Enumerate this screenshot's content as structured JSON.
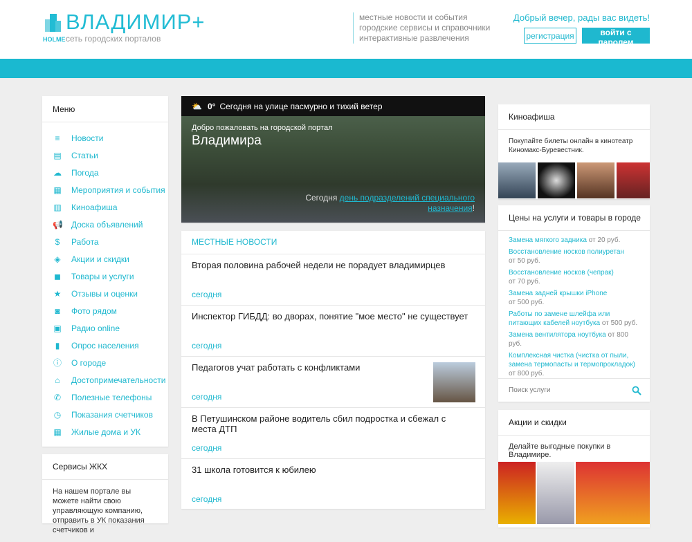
{
  "header": {
    "logo_title": "ВЛАДИМИР+",
    "logo_brand": "HOLME",
    "logo_subtitle": "сеть городских порталов",
    "taglines": [
      "местные новости и события",
      "городские сервисы и справочники",
      "интерактивные развлечения"
    ],
    "greeting": "Добрый вечер, рады вас видеть!",
    "register_label": "регистрация",
    "login_label": "войти с паролем"
  },
  "menu": {
    "title": "Меню",
    "items": [
      {
        "label": "Новости",
        "icon": "≡"
      },
      {
        "label": "Статьи",
        "icon": "▤"
      },
      {
        "label": "Погода",
        "icon": "☁"
      },
      {
        "label": "Мероприятия и события",
        "icon": "▦"
      },
      {
        "label": "Киноафиша",
        "icon": "▥"
      },
      {
        "label": "Доска объявлений",
        "icon": "📢"
      },
      {
        "label": "Работа",
        "icon": "$"
      },
      {
        "label": "Акции и скидки",
        "icon": "◈"
      },
      {
        "label": "Товары и услуги",
        "icon": "◼"
      },
      {
        "label": "Отзывы и оценки",
        "icon": "★"
      },
      {
        "label": "Фото рядом",
        "icon": "◙"
      },
      {
        "label": "Радио online",
        "icon": "▣"
      },
      {
        "label": "Опрос населения",
        "icon": "▮"
      },
      {
        "label": "О городе",
        "icon": "ⓘ"
      },
      {
        "label": "Достопримечательности",
        "icon": "⌂"
      },
      {
        "label": "Полезные телефоны",
        "icon": "✆"
      },
      {
        "label": "Показания счетчиков",
        "icon": "◷"
      },
      {
        "label": "Жилые дома и УК",
        "icon": "▦"
      }
    ]
  },
  "zhkh": {
    "title": "Сервисы ЖКХ",
    "text": "На нашем портале вы можете найти свою управляющую компанию, отправить в УК показания счетчиков и"
  },
  "weather": {
    "temp": "0°",
    "text": "Сегодня на улице пасмурно и тихий ветер"
  },
  "hero": {
    "welcome": "Добро пожаловать на городской портал",
    "city": "Владимира",
    "today_prefix": "Сегодня ",
    "today_link": "день подразделений специального назначения",
    "today_suffix": "!"
  },
  "news": {
    "title": "МЕСТНЫЕ НОВОСТИ",
    "items": [
      {
        "title": "Вторая половина рабочей недели не порадует владимирцев",
        "date": "сегодня"
      },
      {
        "title": "Инспектор ГИБДД: во дворах, понятие \"мое место\" не существует",
        "date": "сегодня"
      },
      {
        "title": "Педагогов учат работать с конфликтами",
        "date": "сегодня"
      },
      {
        "title": "В Петушинском районе водитель сбил подростка и сбежал с места ДТП",
        "date": "сегодня"
      },
      {
        "title": "31 школа готовится к юбилею",
        "date": "сегодня"
      }
    ]
  },
  "kino": {
    "title": "Киноафиша",
    "text": "Покупайте билеты онлайн в кинотеатр Киномакс-Буревестник."
  },
  "prices": {
    "title": "Цены на услуги и товары в городе",
    "items": [
      {
        "name": "Замена мягкого задника",
        "price": " от 20 руб."
      },
      {
        "name": "Восстановление носков полиуретан",
        "price": "от 50 руб."
      },
      {
        "name": "Восстановление носков (чепрак)",
        "price": "от 70 руб."
      },
      {
        "name": "Замена задней крышки iPhone",
        "price": "от 500 руб."
      },
      {
        "name": "Работы по замене шлейфа или питающих кабелей ноутбука",
        "price": " от 500 руб."
      },
      {
        "name": "Замена вентилятора ноутбука",
        "price": " от 800 руб."
      },
      {
        "name": "Комплексная чистка (чистка от пыли, замена термопасты и термопрокладок)",
        "price": "от 800 руб."
      }
    ],
    "search_placeholder": "Поиск услуги"
  },
  "promo": {
    "title": "Акции и скидки",
    "text": "Делайте выгодные покупки в Владимире."
  }
}
